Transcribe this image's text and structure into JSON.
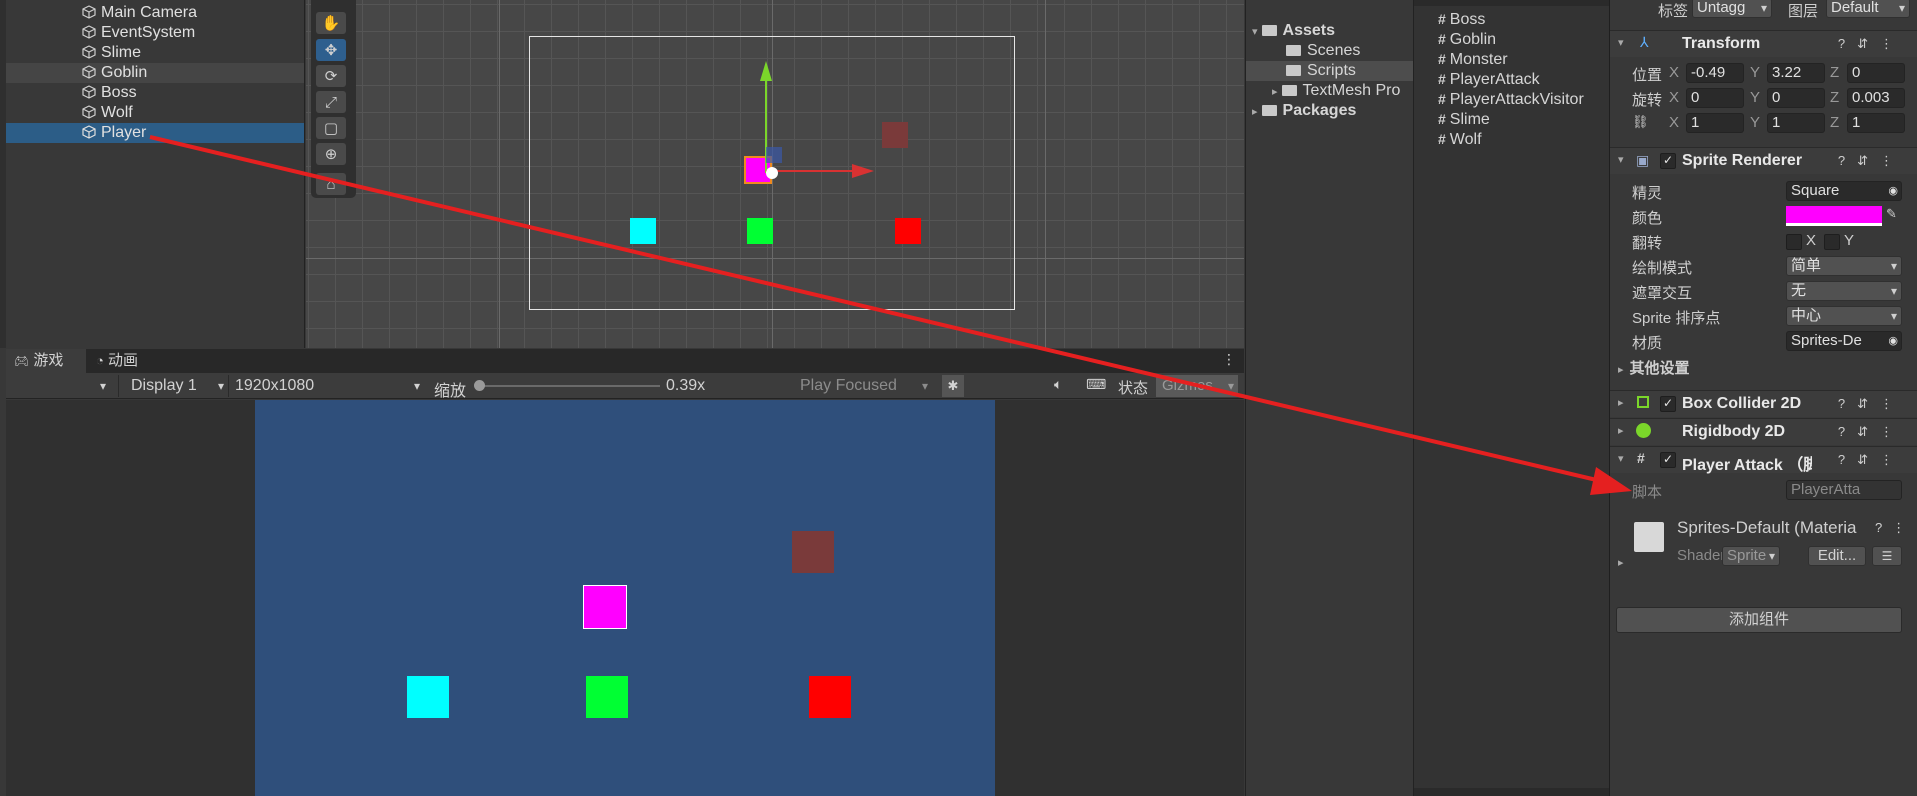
{
  "hierarchy": {
    "items": [
      {
        "label": "Main Camera"
      },
      {
        "label": "EventSystem"
      },
      {
        "label": "Slime"
      },
      {
        "label": "Goblin"
      },
      {
        "label": "Boss"
      },
      {
        "label": "Wolf"
      },
      {
        "label": "Player"
      }
    ],
    "selected": "Player"
  },
  "game_view": {
    "tab_game": "游戏",
    "tab_animation": "动画",
    "display": "Display 1",
    "resolution": "1920x1080",
    "scale_label": "缩放",
    "scale_value": "0.39x",
    "play_mode": "Play Focused",
    "stats": "状态",
    "gizmos": "Gizmos"
  },
  "project": {
    "assets": "Assets",
    "scenes": "Scenes",
    "scripts": "Scripts",
    "textmesh": "TextMesh Pro",
    "packages": "Packages",
    "files": [
      "Boss",
      "Goblin",
      "Monster",
      "PlayerAttack",
      "PlayerAttackVisitor",
      "Slime",
      "Wolf"
    ]
  },
  "inspector": {
    "tag_label": "标签",
    "tag_value": "Untagg",
    "layer_label": "图层",
    "layer_value": "Default",
    "transform": {
      "title": "Transform",
      "position_label": "位置",
      "rotation_label": "旋转",
      "px": "-0.49",
      "py": "3.22",
      "pz": "0",
      "rx": "0",
      "ry": "0",
      "rz": "0.003",
      "sx": "1",
      "sy": "1",
      "sz": "1",
      "x": "X",
      "y": "Y",
      "z": "Z"
    },
    "sprite_renderer": {
      "title": "Sprite Renderer",
      "sprite_label": "精灵",
      "sprite_value": "Square",
      "color_label": "颜色",
      "color_value": "#ff00ff",
      "flip_label": "翻转",
      "flip_x": "X",
      "flip_y": "Y",
      "draw_mode_label": "绘制模式",
      "draw_mode_value": "简单",
      "mask_label": "遮罩交互",
      "mask_value": "无",
      "sort_label": "Sprite 排序点",
      "sort_value": "中心",
      "material_label": "材质",
      "material_value": "Sprites-De",
      "other_settings": "其他设置"
    },
    "box_collider": "Box Collider 2D",
    "rigidbody": "Rigidbody 2D",
    "player_attack": {
      "title": "Player Attack （脚本",
      "script_label": "脚本",
      "script_value": "PlayerAtta"
    },
    "material": {
      "name": "Sprites-Default (Materia",
      "shader_label": "Shader",
      "shader_value": "Sprite",
      "edit_button": "Edit..."
    },
    "add_component": "添加组件"
  },
  "colors": {
    "player": "#ff00ff",
    "slime": "#00ffff",
    "goblin": "#00ff33",
    "boss": "#ff0000",
    "wolf": "#7a3a3a",
    "game_bg": "#2f4f7b",
    "arrow": "#e52020"
  }
}
